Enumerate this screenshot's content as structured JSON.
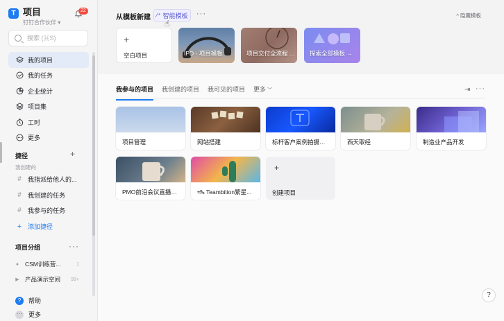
{
  "app": {
    "title": "项目",
    "subtitle": "钉钉合作伙伴",
    "logo": "T",
    "notifications": "22"
  },
  "search": {
    "placeholder": "搜索 (⌘S)"
  },
  "nav": [
    {
      "label": "我的项目",
      "icon": "layers-icon"
    },
    {
      "label": "我的任务",
      "icon": "check-circle-icon"
    },
    {
      "label": "企业统计",
      "icon": "pie-chart-icon"
    },
    {
      "label": "项目集",
      "icon": "stack-icon"
    },
    {
      "label": "工时",
      "icon": "clock-icon"
    },
    {
      "label": "更多",
      "icon": "more-circle-icon"
    }
  ],
  "shortcuts": {
    "title": "捷径",
    "sub": "我创建的",
    "items": [
      "我指派给他人的...",
      "我创建的任务",
      "我参与的任务"
    ],
    "add_label": "添加捷径"
  },
  "groups": {
    "title": "项目分组",
    "items": [
      {
        "label": "CSM训练营...",
        "count": "1"
      },
      {
        "label": "产品演示空间",
        "count": "99+"
      }
    ]
  },
  "footer": {
    "help": "帮助",
    "more": "更多"
  },
  "templates": {
    "title": "从模板新建",
    "smart_label": "智能模板",
    "hide_label": "隐藏模板",
    "cards": [
      "空白项目",
      "IPD - 项目模板",
      "项目交付全流程 ...",
      "探索全部模板"
    ]
  },
  "tabs": [
    "我参与的项目",
    "我创建的项目",
    "我可见的项目",
    "更多"
  ],
  "projects": [
    "项目管理",
    "网站搭建",
    "标杆客户案例拍摄撰写",
    "西天取经",
    "制造业产品开发",
    "PMO前沿会议直播专项",
    "🛥 Teambition繁星...",
    "创建项目"
  ],
  "colors": {
    "accent": "#1f7cf1",
    "smart": "#5b5bd6",
    "badge": "#f04a3f"
  }
}
